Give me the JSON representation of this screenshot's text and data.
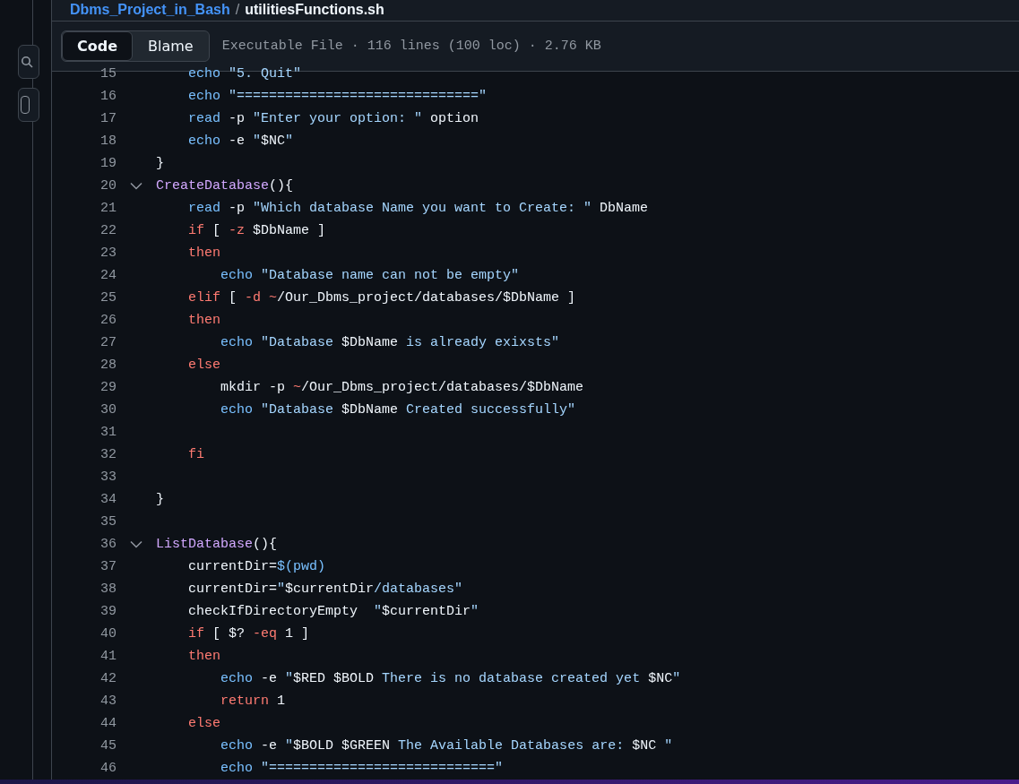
{
  "breadcrumb": {
    "repo": "Dbms_Project_in_Bash",
    "separator": "/",
    "file": "utilitiesFunctions.sh"
  },
  "tabs": [
    {
      "label": "Code",
      "selected": true
    },
    {
      "label": "Blame",
      "selected": false
    }
  ],
  "file_info": "Executable File · 116 lines (100 loc) · 2.76 KB",
  "lines": [
    {
      "n": "15",
      "fold": false,
      "tokens": [
        {
          "kind": "builtin",
          "text": "    echo"
        },
        {
          "kind": "string",
          "text": " \"5. Quit\""
        }
      ]
    },
    {
      "n": "16",
      "fold": false,
      "tokens": [
        {
          "kind": "builtin",
          "text": "    echo"
        },
        {
          "kind": "string",
          "text": " \"==============================\""
        }
      ]
    },
    {
      "n": "17",
      "fold": false,
      "tokens": [
        {
          "kind": "builtin",
          "text": "    read"
        },
        {
          "kind": "plain",
          "text": " -p "
        },
        {
          "kind": "string",
          "text": "\"Enter your option: \""
        },
        {
          "kind": "plain",
          "text": " option"
        }
      ]
    },
    {
      "n": "18",
      "fold": false,
      "tokens": [
        {
          "kind": "builtin",
          "text": "    echo"
        },
        {
          "kind": "plain",
          "text": " -e "
        },
        {
          "kind": "string",
          "text": "\""
        },
        {
          "kind": "plain",
          "text": "$NC"
        },
        {
          "kind": "string",
          "text": "\""
        }
      ]
    },
    {
      "n": "19",
      "fold": false,
      "tokens": [
        {
          "kind": "plain",
          "text": "}"
        }
      ]
    },
    {
      "n": "20",
      "fold": true,
      "tokens": [
        {
          "kind": "func",
          "text": "CreateDatabase"
        },
        {
          "kind": "plain",
          "text": "(){"
        }
      ]
    },
    {
      "n": "21",
      "fold": false,
      "tokens": [
        {
          "kind": "builtin",
          "text": "    read"
        },
        {
          "kind": "plain",
          "text": " -p "
        },
        {
          "kind": "string",
          "text": "\"Which database Name you want to Create: \""
        },
        {
          "kind": "plain",
          "text": " DbName"
        }
      ]
    },
    {
      "n": "22",
      "fold": false,
      "tokens": [
        {
          "kind": "keyword",
          "text": "    if"
        },
        {
          "kind": "plain",
          "text": " [ "
        },
        {
          "kind": "keyword",
          "text": "-z"
        },
        {
          "kind": "plain",
          "text": " $DbName ]"
        }
      ]
    },
    {
      "n": "23",
      "fold": false,
      "tokens": [
        {
          "kind": "keyword",
          "text": "    then"
        }
      ]
    },
    {
      "n": "24",
      "fold": false,
      "tokens": [
        {
          "kind": "builtin",
          "text": "        echo"
        },
        {
          "kind": "string",
          "text": " \"Database name can not be empty\""
        }
      ]
    },
    {
      "n": "25",
      "fold": false,
      "tokens": [
        {
          "kind": "keyword",
          "text": "    elif"
        },
        {
          "kind": "plain",
          "text": " [ "
        },
        {
          "kind": "keyword",
          "text": "-d ~"
        },
        {
          "kind": "plain",
          "text": "/Our_Dbms_project/databases/$DbName ]"
        }
      ]
    },
    {
      "n": "26",
      "fold": false,
      "tokens": [
        {
          "kind": "keyword",
          "text": "    then"
        }
      ]
    },
    {
      "n": "27",
      "fold": false,
      "tokens": [
        {
          "kind": "builtin",
          "text": "        echo"
        },
        {
          "kind": "string",
          "text": " \"Database "
        },
        {
          "kind": "plain",
          "text": "$DbName"
        },
        {
          "kind": "string",
          "text": " is already exixsts\""
        }
      ]
    },
    {
      "n": "28",
      "fold": false,
      "tokens": [
        {
          "kind": "keyword",
          "text": "    else"
        }
      ]
    },
    {
      "n": "29",
      "fold": false,
      "tokens": [
        {
          "kind": "plain",
          "text": "        mkdir -p "
        },
        {
          "kind": "keyword",
          "text": "~"
        },
        {
          "kind": "plain",
          "text": "/Our_Dbms_project/databases/$DbName"
        }
      ]
    },
    {
      "n": "30",
      "fold": false,
      "tokens": [
        {
          "kind": "builtin",
          "text": "        echo"
        },
        {
          "kind": "string",
          "text": " \"Database "
        },
        {
          "kind": "plain",
          "text": "$DbName"
        },
        {
          "kind": "string",
          "text": " Created successfully\""
        }
      ]
    },
    {
      "n": "31",
      "fold": false
    },
    {
      "n": "32",
      "fold": false,
      "tokens": [
        {
          "kind": "keyword",
          "text": "    fi"
        }
      ]
    },
    {
      "n": "33",
      "fold": false
    },
    {
      "n": "34",
      "fold": false,
      "tokens": [
        {
          "kind": "plain",
          "text": "}"
        }
      ]
    },
    {
      "n": "35",
      "fold": false
    },
    {
      "n": "36",
      "fold": true,
      "tokens": [
        {
          "kind": "func",
          "text": "ListDatabase"
        },
        {
          "kind": "plain",
          "text": "(){"
        }
      ]
    },
    {
      "n": "37",
      "fold": false,
      "tokens": [
        {
          "kind": "plain",
          "text": "    currentDir="
        },
        {
          "kind": "builtin",
          "text": "$(pwd)"
        }
      ]
    },
    {
      "n": "38",
      "fold": false,
      "tokens": [
        {
          "kind": "plain",
          "text": "    currentDir="
        },
        {
          "kind": "string",
          "text": "\""
        },
        {
          "kind": "plain",
          "text": "$currentDir"
        },
        {
          "kind": "string",
          "text": "/databases\""
        }
      ]
    },
    {
      "n": "39",
      "fold": false,
      "tokens": [
        {
          "kind": "plain",
          "text": "    checkIfDirectoryEmpty  "
        },
        {
          "kind": "string",
          "text": "\""
        },
        {
          "kind": "plain",
          "text": "$currentDir"
        },
        {
          "kind": "string",
          "text": "\""
        }
      ]
    },
    {
      "n": "40",
      "fold": false,
      "tokens": [
        {
          "kind": "keyword",
          "text": "    if"
        },
        {
          "kind": "plain",
          "text": " [ $? "
        },
        {
          "kind": "keyword",
          "text": "-eq"
        },
        {
          "kind": "plain",
          "text": " 1 ]"
        }
      ]
    },
    {
      "n": "41",
      "fold": false,
      "tokens": [
        {
          "kind": "keyword",
          "text": "    then"
        }
      ]
    },
    {
      "n": "42",
      "fold": false,
      "tokens": [
        {
          "kind": "builtin",
          "text": "        echo"
        },
        {
          "kind": "plain",
          "text": " -e "
        },
        {
          "kind": "string",
          "text": "\""
        },
        {
          "kind": "plain",
          "text": "$RED $BOLD"
        },
        {
          "kind": "string",
          "text": " There is no database created yet "
        },
        {
          "kind": "plain",
          "text": "$NC"
        },
        {
          "kind": "string",
          "text": "\""
        }
      ]
    },
    {
      "n": "43",
      "fold": false,
      "tokens": [
        {
          "kind": "keyword",
          "text": "        return"
        },
        {
          "kind": "plain",
          "text": " 1"
        }
      ]
    },
    {
      "n": "44",
      "fold": false,
      "tokens": [
        {
          "kind": "keyword",
          "text": "    else"
        }
      ]
    },
    {
      "n": "45",
      "fold": false,
      "tokens": [
        {
          "kind": "builtin",
          "text": "        echo"
        },
        {
          "kind": "plain",
          "text": " -e "
        },
        {
          "kind": "string",
          "text": "\""
        },
        {
          "kind": "plain",
          "text": "$BOLD $GREEN"
        },
        {
          "kind": "string",
          "text": " The Available Databases are: "
        },
        {
          "kind": "plain",
          "text": "$NC"
        },
        {
          "kind": "string",
          "text": " \""
        }
      ]
    },
    {
      "n": "46",
      "fold": false,
      "tokens": [
        {
          "kind": "builtin",
          "text": "        echo"
        },
        {
          "kind": "string",
          "text": " \"============================\""
        }
      ]
    }
  ]
}
